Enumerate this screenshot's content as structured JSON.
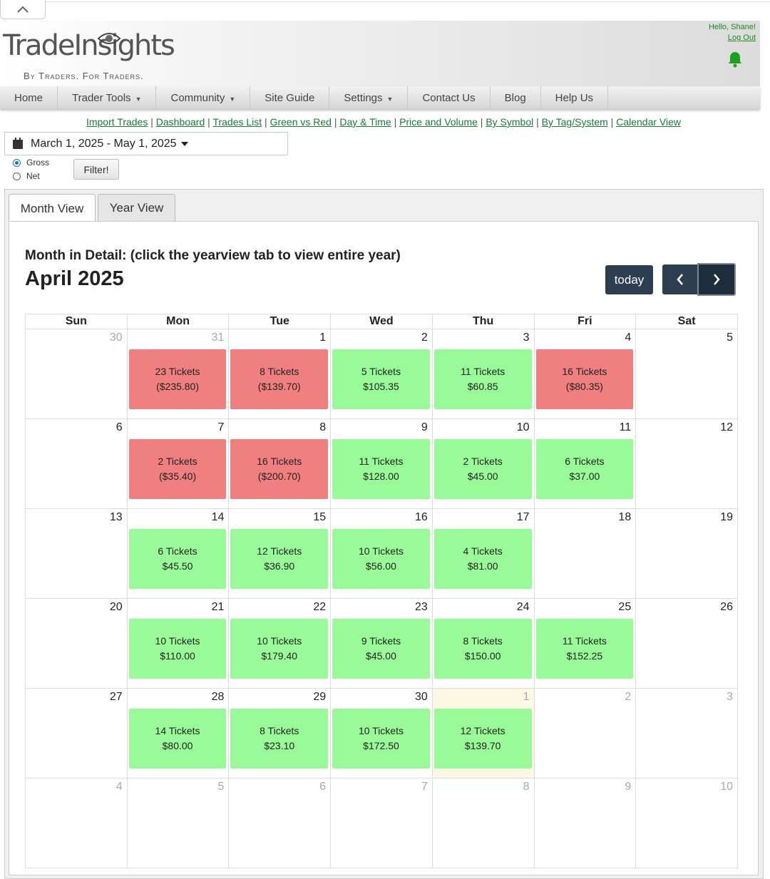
{
  "header": {
    "logo_text": "TradeInsights",
    "logo_tagline": "By Traders. For Traders.",
    "greeting": "Hello, Shane!",
    "logout": "Log Out"
  },
  "nav": [
    {
      "label": "Home",
      "dropdown": false
    },
    {
      "label": "Trader Tools",
      "dropdown": true
    },
    {
      "label": "Community",
      "dropdown": true
    },
    {
      "label": "Site Guide",
      "dropdown": false
    },
    {
      "label": "Settings",
      "dropdown": true
    },
    {
      "label": "Contact Us",
      "dropdown": false
    },
    {
      "label": "Blog",
      "dropdown": false
    },
    {
      "label": "Help Us",
      "dropdown": false
    }
  ],
  "sublinks": [
    "Import Trades",
    "Dashboard",
    "Trades List",
    "Green vs Red",
    "Day & Time",
    "Price and Volume",
    "By Symbol",
    "By Tag/System",
    "Calendar View"
  ],
  "filter": {
    "date_range": "March 1, 2025 - May 1, 2025",
    "options": [
      {
        "label": "Gross",
        "checked": true
      },
      {
        "label": "Net",
        "checked": false
      }
    ],
    "button": "Filter!"
  },
  "tabs": [
    {
      "label": "Month View",
      "active": true
    },
    {
      "label": "Year View",
      "active": false
    }
  ],
  "calendar": {
    "heading": "Month in Detail: (click the yearview tab to view entire year)",
    "month": "April 2025",
    "today_button": "today",
    "weekdays": [
      "Sun",
      "Mon",
      "Tue",
      "Wed",
      "Thu",
      "Fri",
      "Sat"
    ],
    "weeks": [
      [
        {
          "d": "30",
          "o": true
        },
        {
          "d": "31",
          "o": true,
          "t": "23 Tickets",
          "v": "($235.80)",
          "c": "red"
        },
        {
          "d": "1",
          "t": "8 Tickets",
          "v": "($139.70)",
          "c": "red"
        },
        {
          "d": "2",
          "t": "5 Tickets",
          "v": "$105.35",
          "c": "green"
        },
        {
          "d": "3",
          "t": "11 Tickets",
          "v": "$60.85",
          "c": "green"
        },
        {
          "d": "4",
          "t": "16 Tickets",
          "v": "($80.35)",
          "c": "red"
        },
        {
          "d": "5"
        }
      ],
      [
        {
          "d": "6"
        },
        {
          "d": "7",
          "t": "2 Tickets",
          "v": "($35.40)",
          "c": "red"
        },
        {
          "d": "8",
          "t": "16 Tickets",
          "v": "($200.70)",
          "c": "red"
        },
        {
          "d": "9",
          "t": "11 Tickets",
          "v": "$128.00",
          "c": "green"
        },
        {
          "d": "10",
          "t": "2 Tickets",
          "v": "$45.00",
          "c": "green"
        },
        {
          "d": "11",
          "t": "6 Tickets",
          "v": "$37.00",
          "c": "green"
        },
        {
          "d": "12"
        }
      ],
      [
        {
          "d": "13"
        },
        {
          "d": "14",
          "t": "6 Tickets",
          "v": "$45.50",
          "c": "green"
        },
        {
          "d": "15",
          "t": "12 Tickets",
          "v": "$36.90",
          "c": "green"
        },
        {
          "d": "16",
          "t": "10 Tickets",
          "v": "$56.00",
          "c": "green"
        },
        {
          "d": "17",
          "t": "4 Tickets",
          "v": "$81.00",
          "c": "green"
        },
        {
          "d": "18"
        },
        {
          "d": "19"
        }
      ],
      [
        {
          "d": "20"
        },
        {
          "d": "21",
          "t": "10 Tickets",
          "v": "$110.00",
          "c": "green"
        },
        {
          "d": "22",
          "t": "10 Tickets",
          "v": "$179.40",
          "c": "green"
        },
        {
          "d": "23",
          "t": "9 Tickets",
          "v": "$45.00",
          "c": "green"
        },
        {
          "d": "24",
          "t": "8 Tickets",
          "v": "$150.00",
          "c": "green"
        },
        {
          "d": "25",
          "t": "11 Tickets",
          "v": "$152.25",
          "c": "green"
        },
        {
          "d": "26"
        }
      ],
      [
        {
          "d": "27"
        },
        {
          "d": "28",
          "t": "14 Tickets",
          "v": "$80.00",
          "c": "green"
        },
        {
          "d": "29",
          "t": "8 Tickets",
          "v": "$23.10",
          "c": "green"
        },
        {
          "d": "30",
          "t": "10 Tickets",
          "v": "$172.50",
          "c": "green"
        },
        {
          "d": "1",
          "o": true,
          "today": true,
          "t": "12 Tickets",
          "v": "$139.70",
          "c": "green"
        },
        {
          "d": "2",
          "o": true
        },
        {
          "d": "3",
          "o": true
        }
      ],
      [
        {
          "d": "4",
          "o": true
        },
        {
          "d": "5",
          "o": true
        },
        {
          "d": "6",
          "o": true
        },
        {
          "d": "7",
          "o": true
        },
        {
          "d": "8",
          "o": true
        },
        {
          "d": "9",
          "o": true
        },
        {
          "d": "10",
          "o": true
        }
      ]
    ]
  },
  "colors": {
    "profit": "#98fb98",
    "loss": "#f08080",
    "accent": "#1a7a3a",
    "button_dark": "#2c3e50"
  }
}
